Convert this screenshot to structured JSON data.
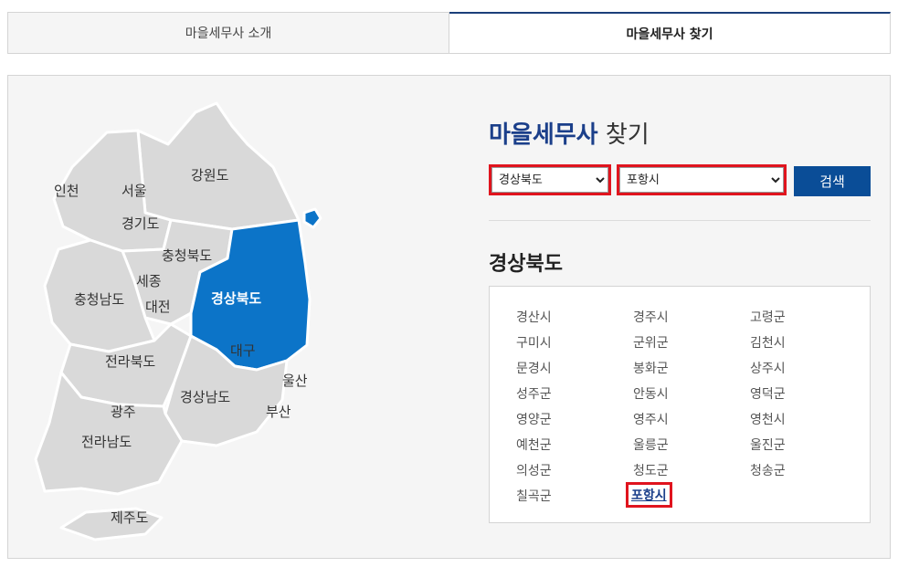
{
  "tabs": [
    {
      "label": "마을세무사 소개",
      "active": false
    },
    {
      "label": "마을세무사 찾기",
      "active": true
    }
  ],
  "map": {
    "active_region": "경상북도",
    "active_color": "#0c74c8",
    "inactive_color": "#d9d9d9",
    "labels": {
      "incheon": "인천",
      "seoul": "서울",
      "gangwon": "강원도",
      "gyeonggi": "경기도",
      "chungbuk": "충청북도",
      "sejong": "세종",
      "chungnam": "충청남도",
      "daejeon": "대전",
      "gyeongbuk": "경상북도",
      "daegu": "대구",
      "jeonbuk": "전라북도",
      "ulsan": "울산",
      "gyeongnam": "경상남도",
      "gwangju": "광주",
      "busan": "부산",
      "jeonnam": "전라남도",
      "jeju": "제주도"
    }
  },
  "finder": {
    "title_highlight": "마을세무사",
    "title_rest": "찾기",
    "province_select": {
      "value": "경상북도",
      "options": [
        "경상북도"
      ]
    },
    "city_select": {
      "value": "포항시",
      "options": [
        "포항시"
      ]
    },
    "search_label": "검색",
    "region_title": "경상북도",
    "cities": [
      "경산시",
      "경주시",
      "고령군",
      "구미시",
      "군위군",
      "김천시",
      "문경시",
      "봉화군",
      "상주시",
      "성주군",
      "안동시",
      "영덕군",
      "영양군",
      "영주시",
      "영천시",
      "예천군",
      "울릉군",
      "울진군",
      "의성군",
      "청도군",
      "청송군",
      "칠곡군",
      "포항시"
    ],
    "selected_city": "포항시"
  },
  "colors": {
    "accent_navy": "#1b3f8a",
    "button": "#0a4d97",
    "highlight_red": "#e0141e"
  }
}
